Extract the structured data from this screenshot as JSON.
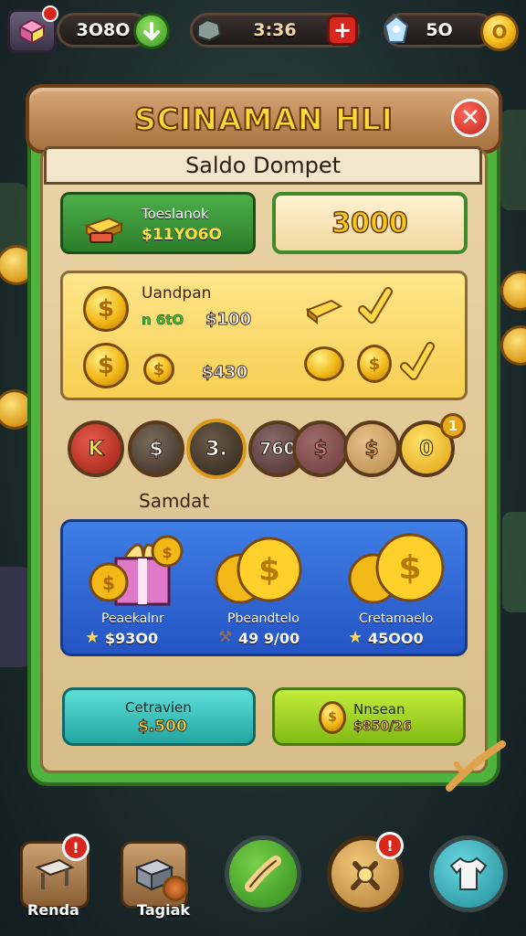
{
  "topbar": {
    "gems": "3O8O",
    "timer": "3:36",
    "coins": "5O"
  },
  "dialog": {
    "title": "SCINAMAN HLI",
    "subtitle": "Saldo Dompet",
    "tab_green": {
      "label": "Toeslanok",
      "value": "$11YO6O"
    },
    "balance": "3000",
    "rewards": {
      "heading": "Uandpan",
      "line1_prefix": "n 6tO",
      "line1_value": "$100",
      "line2_value": "$430"
    },
    "tokens": [
      "K",
      "$",
      "3.",
      "760",
      "$",
      "$",
      "0"
    ],
    "token_badge": "1",
    "section_label": "Samdat",
    "shop": [
      {
        "name": "Peaekalnr",
        "price": "$93O0"
      },
      {
        "name": "Pbeandtelo",
        "price": "49 9/00"
      },
      {
        "name": "Cretamaelo",
        "price": "45OO0"
      }
    ],
    "btn_teal": {
      "label": "Cetravien",
      "value": "$.500"
    },
    "btn_lime": {
      "label": "Nnsean",
      "value": "$850/26"
    }
  },
  "nav": {
    "items": [
      {
        "label": "Renda",
        "badge": "!"
      },
      {
        "label": "Tagiak",
        "badge": ""
      },
      {
        "label": "",
        "badge": ""
      },
      {
        "label": "",
        "badge": "!"
      },
      {
        "label": "",
        "badge": ""
      }
    ]
  },
  "colors": {
    "panel_green": "#4eb43e",
    "shop_blue": "#2f66d6",
    "title_gold": "#ffd83a"
  }
}
